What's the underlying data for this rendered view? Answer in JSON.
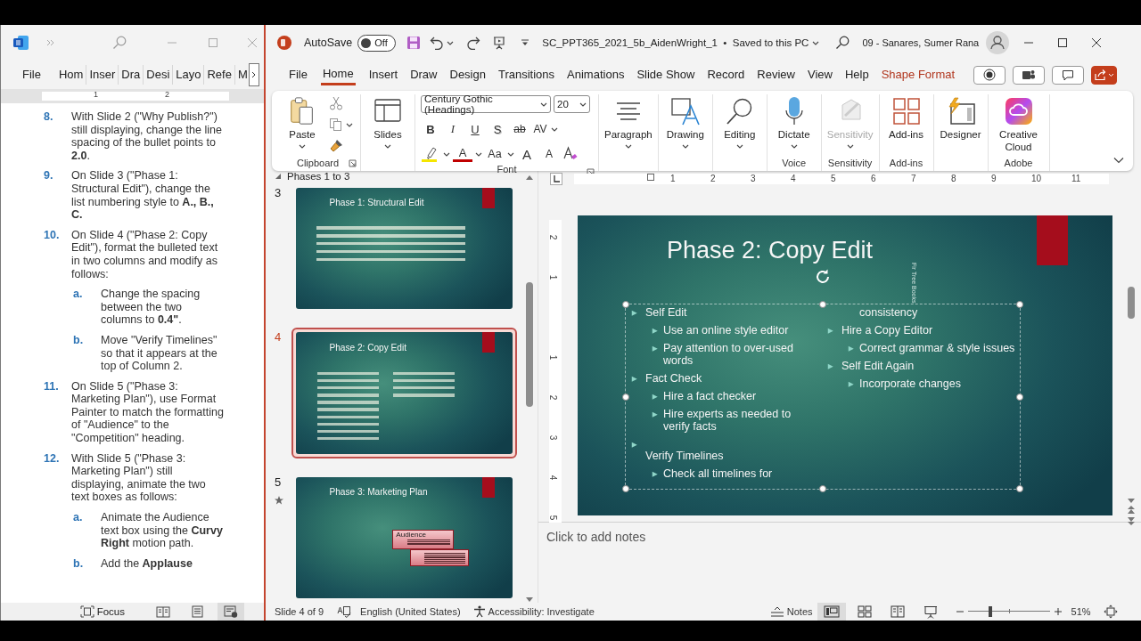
{
  "word": {
    "tabs": [
      {
        "label": "File",
        "selected": false
      },
      {
        "label": "Hom",
        "selected": false
      },
      {
        "label": "Inser",
        "selected": false
      },
      {
        "label": "Dra",
        "selected": false
      },
      {
        "label": "Desi",
        "selected": false
      },
      {
        "label": "Layo",
        "selected": false
      },
      {
        "label": "Refe",
        "selected": false
      },
      {
        "label": "M",
        "selected": false
      }
    ],
    "ruler_labels": [
      "1",
      "2"
    ],
    "steps": [
      {
        "number": "8.",
        "text": "With Slide 2 (\"Why Publish?\") still displaying, change the line spacing of the bullet points to **2.0**."
      },
      {
        "number": "9.",
        "text": "On Slide 3 (\"Phase 1: Structural Edit\"), change the list numbering style to **A., B., C.**"
      },
      {
        "number": "10.",
        "text": "On Slide 4 (\"Phase 2: Copy Edit\"), format the bulleted text in two columns and modify as follows:",
        "children": [
          {
            "number": "a.",
            "text": "Change the spacing between the two columns to **0.4\"**."
          },
          {
            "number": "b.",
            "text": "Move \"Verify Timelines\" so that it appears at the top of Column 2."
          }
        ]
      },
      {
        "number": "11.",
        "text": "On Slide 5 (\"Phase 3: Marketing Plan\"), use Format Painter to match the formatting of \"Audience\" to the \"Competition\" heading."
      },
      {
        "number": "12.",
        "text": "With Slide 5 (\"Phase 3: Marketing Plan\") still displaying, animate the two text boxes as follows:",
        "children": [
          {
            "number": "a.",
            "text": "Animate the Audience text box using the **Curvy Right** motion path."
          },
          {
            "number": "b.",
            "text": "Add the **Applause**"
          }
        ]
      }
    ],
    "status_bar": {
      "focus": "Focus",
      "views": [
        {
          "selected": false
        },
        {
          "selected": false
        },
        {
          "selected": true
        }
      ]
    }
  },
  "powerpoint": {
    "autosave": {
      "label": "AutoSave",
      "on": false,
      "state_text": "Off"
    },
    "file_title": "SC_PPT365_2021_5b_AidenWright_1  •  Saved to this PC",
    "user_name": "09 - Sanares, Sumer Rana",
    "tabs": [
      {
        "label": "File",
        "selected": false,
        "kind": "standard"
      },
      {
        "label": "Home",
        "selected": true,
        "kind": "standard"
      },
      {
        "label": "Insert",
        "selected": false,
        "kind": "standard"
      },
      {
        "label": "Draw",
        "selected": false,
        "kind": "standard"
      },
      {
        "label": "Design",
        "selected": false,
        "kind": "standard"
      },
      {
        "label": "Transitions",
        "selected": false,
        "kind": "standard"
      },
      {
        "label": "Animations",
        "selected": false,
        "kind": "standard"
      },
      {
        "label": "Slide Show",
        "selected": false,
        "kind": "standard"
      },
      {
        "label": "Record",
        "selected": false,
        "kind": "standard"
      },
      {
        "label": "Review",
        "selected": false,
        "kind": "standard"
      },
      {
        "label": "View",
        "selected": false,
        "kind": "standard"
      },
      {
        "label": "Help",
        "selected": false,
        "kind": "standard"
      },
      {
        "label": "Shape Format",
        "selected": false,
        "kind": "contextual"
      }
    ],
    "ribbon": {
      "groups": [
        {
          "kind": "clipboard",
          "label": "Clipboard",
          "launcher": true,
          "buttons": [
            {
              "label": "Paste",
              "disabled": false,
              "dropdown": true
            }
          ]
        },
        {
          "kind": "buttons",
          "buttons": [
            {
              "label": "Slides",
              "disabled": false,
              "dropdown": true
            }
          ]
        },
        {
          "kind": "font",
          "label": "Font",
          "launcher": true,
          "font_name": "Century Gothic (Headings)",
          "font_size": "20",
          "row1": [
            "B",
            "I",
            "U",
            "S",
            "ab",
            "AV"
          ],
          "row2": [
            "A",
            "Aa",
            "A",
            "A"
          ]
        },
        {
          "kind": "buttons",
          "buttons": [
            {
              "label": "Paragraph",
              "disabled": false,
              "dropdown": true
            }
          ]
        },
        {
          "kind": "buttons",
          "buttons": [
            {
              "label": "Drawing",
              "disabled": false,
              "dropdown": true
            }
          ]
        },
        {
          "kind": "buttons",
          "buttons": [
            {
              "label": "Editing",
              "disabled": false,
              "dropdown": true
            }
          ]
        },
        {
          "kind": "buttons",
          "label": "Voice",
          "buttons": [
            {
              "label": "Dictate",
              "disabled": false,
              "dropdown": true
            }
          ]
        },
        {
          "kind": "buttons",
          "label": "Sensitivity",
          "buttons": [
            {
              "label": "Sensitivity",
              "disabled": true,
              "dropdown": true
            }
          ]
        },
        {
          "kind": "buttons",
          "label": "Add-ins",
          "buttons": [
            {
              "label": "Add-ins",
              "disabled": false,
              "dropdown": false
            }
          ]
        },
        {
          "kind": "buttons",
          "buttons": [
            {
              "label": "Designer",
              "disabled": false,
              "dropdown": false
            }
          ]
        },
        {
          "kind": "buttons",
          "label": "Adobe",
          "buttons": [
            {
              "label": "Creative Cloud",
              "disabled": false,
              "dropdown": false
            }
          ]
        }
      ]
    },
    "thumbnails": {
      "section": "Phases 1 to 3",
      "slides": [
        {
          "number": "3",
          "selected": false,
          "animated": false,
          "title": "Phase 1: Structural Edit",
          "kind": "list"
        },
        {
          "number": "4",
          "selected": true,
          "animated": false,
          "title": "Phase 2: Copy Edit",
          "kind": "columns"
        },
        {
          "number": "5",
          "selected": false,
          "animated": true,
          "title": "Phase 3: Marketing Plan",
          "kind": "boxes",
          "boxes": [
            {
              "kind": "titled",
              "heading": "Audience"
            },
            {
              "kind": "untitled"
            }
          ]
        }
      ]
    },
    "h_ruler": [
      "1",
      "2",
      "3",
      "4",
      "5",
      "6",
      "7",
      "8",
      "9",
      "10",
      "11"
    ],
    "v_ruler": [
      "2",
      "1",
      "1",
      "2",
      "3",
      "4",
      "5"
    ],
    "slide": {
      "title": "Phase 2: Copy Edit",
      "side_text": "Fir Tree Books",
      "text_box": {
        "selected": true,
        "columns": [
          [
            {
              "kind": "bullet",
              "text": "Self Edit",
              "children": [
                {
                  "kind": "bullet",
                  "text": "Use an online style editor"
                },
                {
                  "kind": "bullet",
                  "text": "Pay attention to over-used words"
                }
              ]
            },
            {
              "kind": "bullet",
              "text": "Fact Check",
              "children": [
                {
                  "kind": "bullet",
                  "text": "Hire a fact checker"
                },
                {
                  "kind": "bullet",
                  "text": "Hire experts as needed to verify facts"
                }
              ]
            },
            {
              "kind": "empty"
            },
            {
              "kind": "plain",
              "text": "Verify Timelines",
              "children": [
                {
                  "kind": "bullet",
                  "text": "Check all timelines for"
                }
              ]
            }
          ],
          [
            {
              "kind": "continuation",
              "text": "consistency"
            },
            {
              "kind": "bullet",
              "text": "Hire a Copy Editor",
              "children": [
                {
                  "kind": "bullet",
                  "text": "Correct grammar & style issues"
                }
              ]
            },
            {
              "kind": "bullet",
              "text": "Self Edit Again",
              "children": [
                {
                  "kind": "bullet",
                  "text": "Incorporate changes"
                }
              ]
            }
          ]
        ]
      }
    },
    "notes": {
      "placeholder": "Click to add notes"
    },
    "status_bar": {
      "slide_counter": "Slide 4 of 9",
      "language": "English (United States)",
      "accessibility": "Accessibility: Investigate",
      "notes": "Notes",
      "views": [
        {
          "selected": true
        },
        {
          "selected": false
        },
        {
          "selected": false
        },
        {
          "selected": false
        }
      ],
      "zoom": {
        "level": 0.28
      },
      "zoom_text": "51%"
    }
  }
}
